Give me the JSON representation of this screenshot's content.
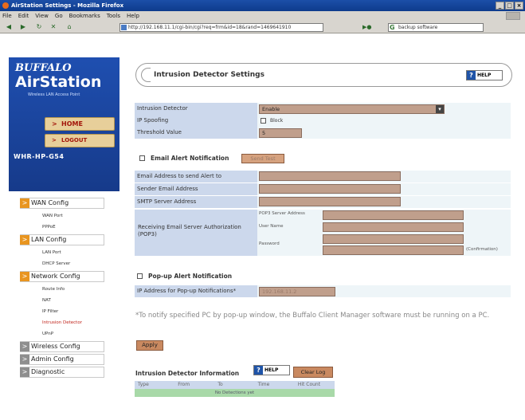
{
  "window": {
    "title": "AirStation Settings - Mozilla Firefox",
    "controls": [
      "_",
      "□",
      "×"
    ]
  },
  "menubar": {
    "items": [
      "File",
      "Edit",
      "View",
      "Go",
      "Bookmarks",
      "Tools",
      "Help"
    ]
  },
  "navbar": {
    "url": "http://192.168.11.1/cgi-bin/cgi?req=frm&id=18&rand=1469641910",
    "search_value": "backup software",
    "icons": [
      "back-icon",
      "forward-icon",
      "reload-icon",
      "stop-icon",
      "home-icon"
    ]
  },
  "sidebar": {
    "brand": "BUFFALO",
    "product": "AirStation",
    "tagline": "Wireless LAN Access Point",
    "home_label": "HOME",
    "logout_label": "LOGOUT",
    "model": "WHR-HP-G54",
    "sections": [
      {
        "label": "WAN Config",
        "subs": [
          "WAN Port",
          "PPPoE"
        ]
      },
      {
        "label": "LAN Config",
        "subs": [
          "LAN Port",
          "DHCP Server"
        ]
      },
      {
        "label": "Network Config",
        "subs": [
          "Route Info",
          "NAT",
          "IP Filter",
          "Intrusion Detector",
          "UPnP"
        ]
      },
      {
        "label": "Wireless Config",
        "subs": []
      },
      {
        "label": "Admin Config",
        "subs": []
      },
      {
        "label": "Diagnostic",
        "subs": []
      }
    ]
  },
  "main": {
    "title": "Intrusion Detector Settings",
    "help_label": "HELP",
    "intrusion_detector": {
      "label": "Intrusion Detector",
      "value": "Enable"
    },
    "ip_spoofing": {
      "label": "IP Spoofing",
      "option": "Block",
      "checked": false
    },
    "threshold": {
      "label": "Threshold Value",
      "value": "5"
    },
    "email_alert": {
      "heading": "Email Alert Notification",
      "test_button": "Send Test",
      "send_to_label": "Email Address to send Alert to",
      "sender_label": "Sender Email Address",
      "smtp_label": "SMTP Server Address",
      "pop3_label": "Receiving Email Server Authorization (POP3)",
      "pop3_server_label": "POP3 Server Address",
      "username_label": "User Name",
      "password_label": "Password",
      "confirmation_label": "(Confirmation)"
    },
    "popup_alert": {
      "heading": "Pop-up Alert Notification",
      "ip_label": "IP Address for Pop-up Notifications*",
      "ip_value": "192.168.11.2"
    },
    "note": "*To notify specified PC by pop-up window, the Buffalo Client Manager software must be running on a PC.",
    "apply_label": "Apply",
    "info": {
      "heading": "Intrusion Detector Information",
      "help_label": "HELP",
      "clear_log": "Clear Log",
      "columns": [
        "Type",
        "From",
        "To",
        "Time",
        "Hit Count"
      ],
      "empty_row": "No Detections yet"
    }
  }
}
